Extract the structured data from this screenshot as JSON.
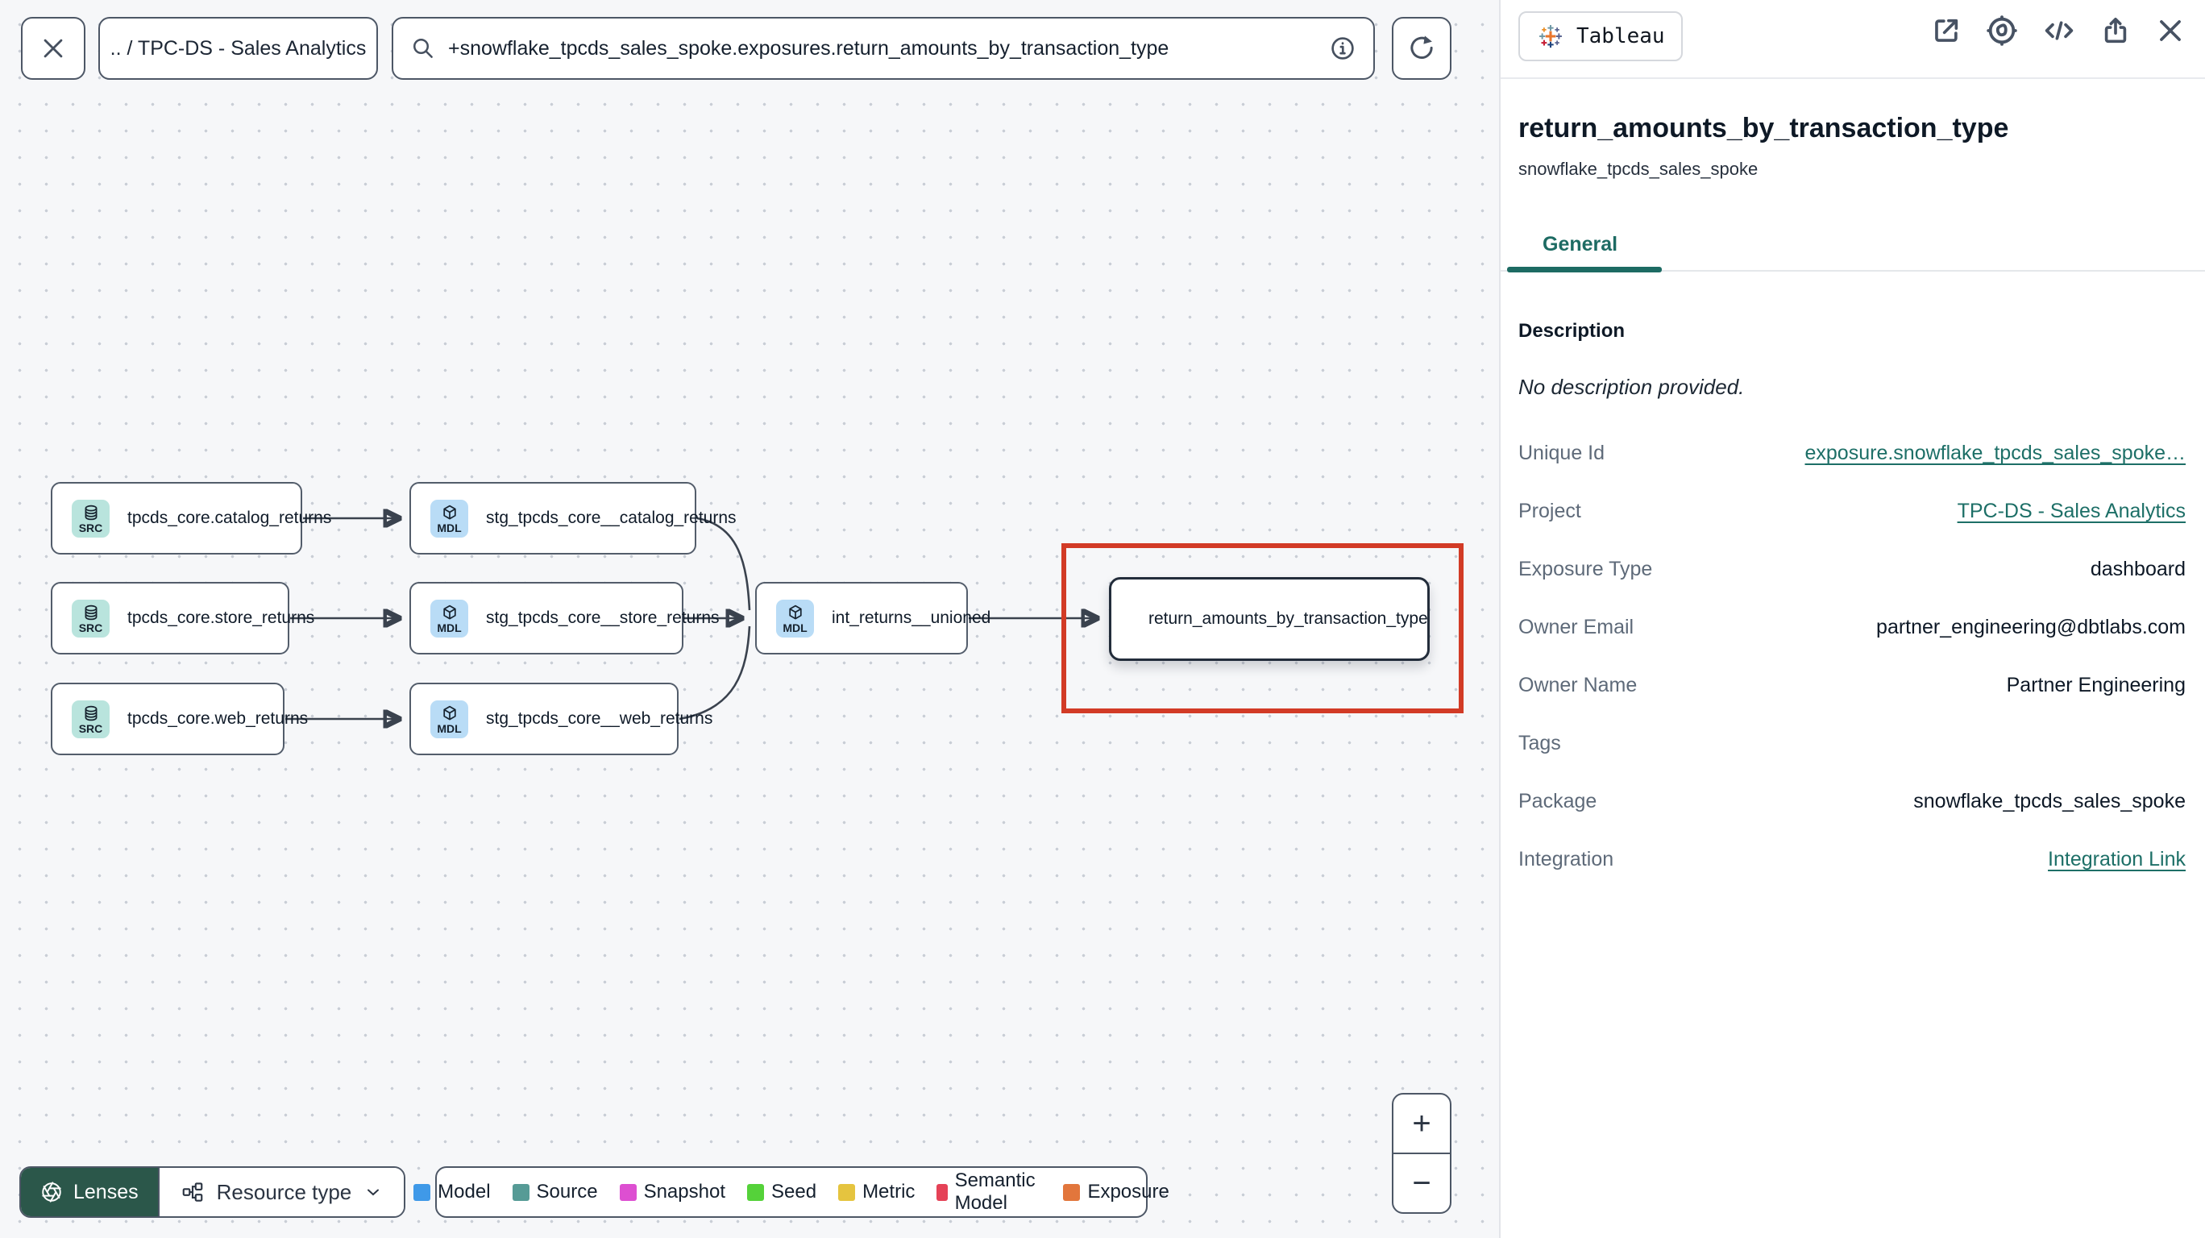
{
  "topbar": {
    "close_label": "close",
    "breadcrumb": ".. / TPC-DS - Sales Analytics",
    "search_value": "+snowflake_tpcds_sales_spoke.exposures.return_amounts_by_transaction_type"
  },
  "graph": {
    "badges": {
      "source": "SRC",
      "model": "MDL"
    },
    "nodes": [
      {
        "id": "src_catalog",
        "type": "source",
        "label": "tpcds_core.catalog_returns"
      },
      {
        "id": "src_store",
        "type": "source",
        "label": "tpcds_core.store_returns"
      },
      {
        "id": "src_web",
        "type": "source",
        "label": "tpcds_core.web_returns"
      },
      {
        "id": "stg_catalog",
        "type": "model",
        "label": "stg_tpcds_core__catalog_returns"
      },
      {
        "id": "stg_store",
        "type": "model",
        "label": "stg_tpcds_core__store_returns"
      },
      {
        "id": "stg_web",
        "type": "model",
        "label": "stg_tpcds_core__web_returns"
      },
      {
        "id": "int_unioned",
        "type": "model",
        "label": "int_returns__unioned"
      },
      {
        "id": "exposure",
        "type": "exposure",
        "label": "return_amounts_by_transaction_type",
        "selected": true
      }
    ],
    "edges": [
      [
        "src_catalog",
        "stg_catalog"
      ],
      [
        "src_store",
        "stg_store"
      ],
      [
        "src_web",
        "stg_web"
      ],
      [
        "stg_catalog",
        "int_unioned"
      ],
      [
        "stg_store",
        "int_unioned"
      ],
      [
        "stg_web",
        "int_unioned"
      ],
      [
        "int_unioned",
        "exposure"
      ]
    ]
  },
  "toolbar": {
    "lenses_label": "Lenses",
    "resource_type_label": "Resource type"
  },
  "legend": {
    "items": [
      {
        "label": "Model",
        "color": "#3F99E8"
      },
      {
        "label": "Source",
        "color": "#569B96"
      },
      {
        "label": "Snapshot",
        "color": "#DD4FD1"
      },
      {
        "label": "Seed",
        "color": "#55D23A"
      },
      {
        "label": "Metric",
        "color": "#E5C43F"
      },
      {
        "label": "Semantic Model",
        "color": "#E54257"
      },
      {
        "label": "Exposure",
        "color": "#E2763C"
      }
    ]
  },
  "zoom_controls": {
    "zoom_in": "+",
    "zoom_out": "−"
  },
  "panel": {
    "integration_badge": "Tableau",
    "title": "return_amounts_by_transaction_type",
    "subtitle": "snowflake_tpcds_sales_spoke",
    "tabs": [
      {
        "label": "General",
        "active": true
      }
    ],
    "description_heading": "Description",
    "description_empty": "No description provided.",
    "rows": [
      {
        "label": "Unique Id",
        "value": "exposure.snowflake_tpcds_sales_spoke…",
        "link": true
      },
      {
        "label": "Project",
        "value": "TPC-DS - Sales Analytics",
        "link": true
      },
      {
        "label": "Exposure Type",
        "value": "dashboard"
      },
      {
        "label": "Owner Email",
        "value": "partner_engineering@dbtlabs.com"
      },
      {
        "label": "Owner Name",
        "value": "Partner Engineering"
      },
      {
        "label": "Tags",
        "value": ""
      },
      {
        "label": "Package",
        "value": "snowflake_tpcds_sales_spoke"
      },
      {
        "label": "Integration",
        "value": "Integration Link",
        "link": true
      }
    ]
  },
  "colors": {
    "accent_teal": "#1d6b63",
    "highlight_red": "#d23b26",
    "lenses_green": "#2b574a",
    "source_icon_bg": "#b9e4dd",
    "model_icon_bg": "#b9dcf6"
  }
}
